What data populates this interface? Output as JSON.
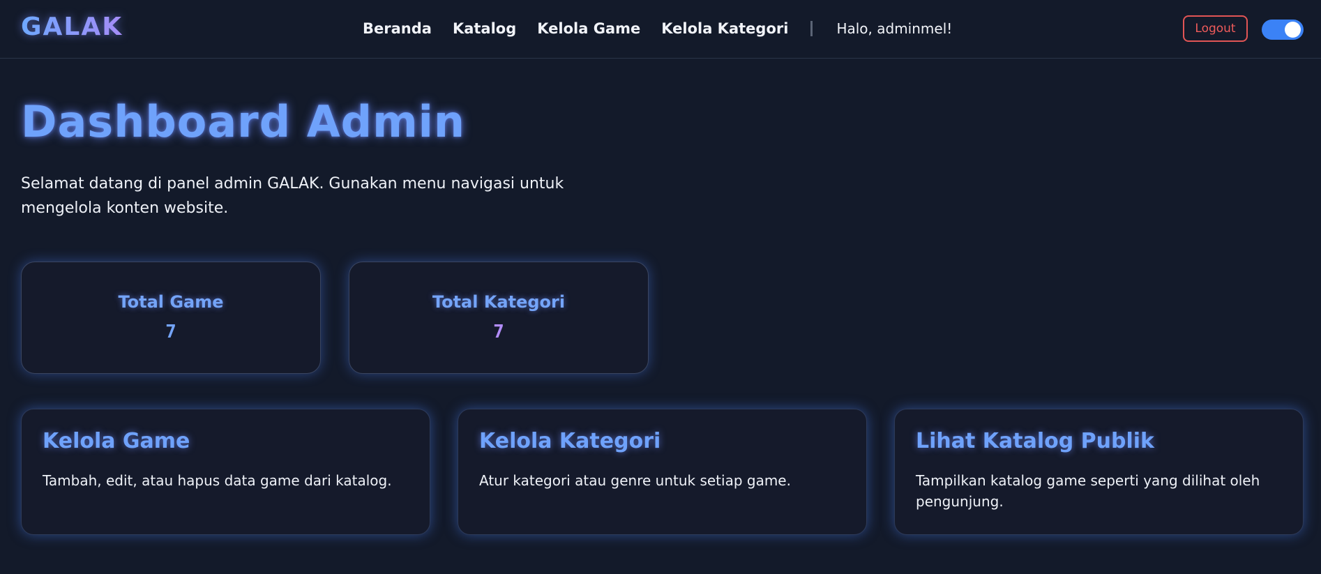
{
  "navbar": {
    "logo": "GALAK",
    "links": [
      {
        "label": "Beranda"
      },
      {
        "label": "Katalog"
      },
      {
        "label": "Kelola Game"
      },
      {
        "label": "Kelola Kategori"
      }
    ],
    "greeting": "Halo, adminmel!",
    "logout_label": "Logout",
    "theme_toggle_on": true
  },
  "main": {
    "title": "Dashboard Admin",
    "intro": "Selamat datang di panel admin GALAK. Gunakan menu navigasi untuk mengelola konten website.",
    "stats": [
      {
        "label": "Total Game",
        "value": "7"
      },
      {
        "label": "Total Kategori",
        "value": "7"
      }
    ],
    "actions": [
      {
        "title": "Kelola Game",
        "description": "Tambah, edit, atau hapus data game dari katalog."
      },
      {
        "title": "Kelola Kategori",
        "description": "Atur kategori atau genre untuk setiap game."
      },
      {
        "title": "Lihat Katalog Publik",
        "description": "Tampilkan katalog game seperti yang dilihat oleh pengunjung."
      }
    ]
  },
  "colors": {
    "background": "#131a2a",
    "accent_blue": "#6fa2fb",
    "accent_purple": "#b28cf9",
    "logout_red": "#e25555",
    "toggle_blue": "#3b82f6"
  }
}
